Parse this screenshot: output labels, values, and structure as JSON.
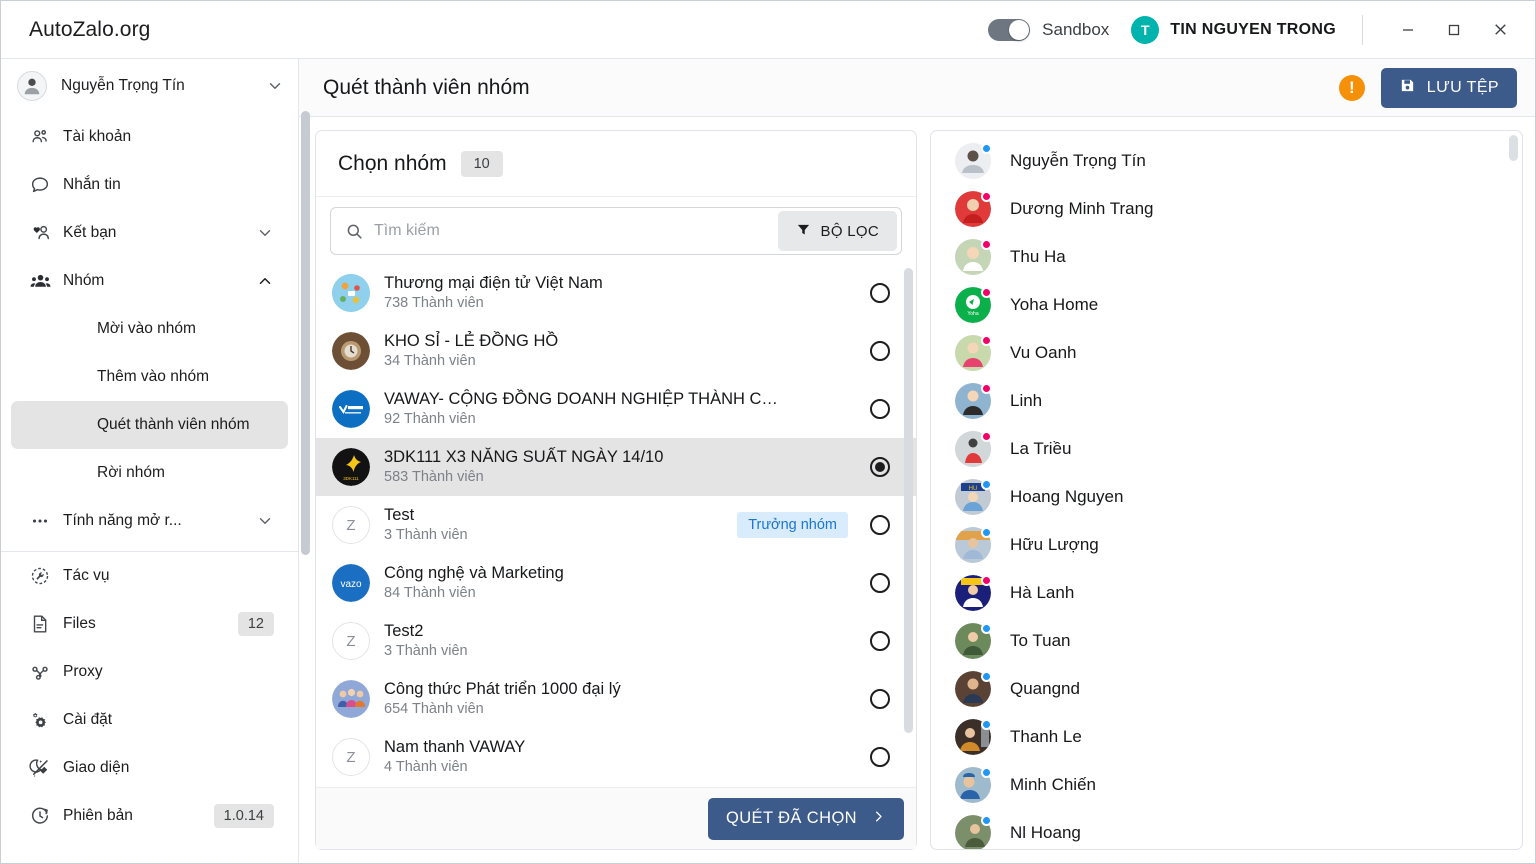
{
  "titlebar": {
    "app_title": "AutoZalo.org",
    "sandbox_label": "Sandbox",
    "sandbox_on": false,
    "user_initial": "T",
    "user_name": "TIN NGUYEN TRONG",
    "minimize": "–",
    "maximize": "□",
    "close": "×",
    "accent_avatar": "#00b3ad"
  },
  "sidebar": {
    "account_name": "Nguyễn Trọng Tín",
    "items": [
      {
        "label": "Tài khoản",
        "icon": "users-icon",
        "type": "item"
      },
      {
        "label": "Nhắn tin",
        "icon": "chat-icon",
        "type": "item"
      },
      {
        "label": "Kết bạn",
        "icon": "add-friend-icon",
        "type": "item",
        "chevron": "down"
      },
      {
        "label": "Nhóm",
        "icon": "group-icon",
        "type": "item",
        "chevron": "up"
      },
      {
        "label": "Mời vào nhóm",
        "type": "sub"
      },
      {
        "label": "Thêm vào nhóm",
        "type": "sub"
      },
      {
        "label": "Quét thành viên nhóm",
        "type": "sub",
        "active": true
      },
      {
        "label": "Rời nhóm",
        "type": "sub"
      },
      {
        "label": "Tính năng mở r...",
        "icon": "dots-icon",
        "type": "item",
        "chevron": "down"
      }
    ],
    "bottom_items": [
      {
        "label": "Tác vụ",
        "icon": "task-icon"
      },
      {
        "label": "Files",
        "icon": "file-icon",
        "badge": "12"
      },
      {
        "label": "Proxy",
        "icon": "proxy-icon"
      },
      {
        "label": "Cài đặt",
        "icon": "gear-icon"
      },
      {
        "label": "Giao diện",
        "icon": "theme-icon"
      },
      {
        "label": "Phiên bản",
        "icon": "version-icon",
        "badge": "1.0.14"
      }
    ]
  },
  "header": {
    "page_title": "Quét thành viên nhóm",
    "warning_symbol": "!",
    "save_label": "LƯU TỆP",
    "save_color": "#3c5b8b",
    "warning_color": "#f79009"
  },
  "group_panel": {
    "title": "Chọn nhóm",
    "count": "10",
    "search_placeholder": "Tìm kiếm",
    "search_value": "",
    "filter_label": "BỘ LỌC",
    "scan_label": "QUÉT ĐÃ CHỌN",
    "member_suffix": "Thành viên",
    "leader_tag": "Trưởng nhóm",
    "groups": [
      {
        "name": "Thương mại điện tử Việt Nam",
        "members": "738 Thành viên",
        "selected": false,
        "avatar_type": "image",
        "avatar_color": "#7fc7e8",
        "initial": ""
      },
      {
        "name": "KHO SỈ - LẺ ĐỒNG HỒ",
        "members": "34 Thành viên",
        "selected": false,
        "avatar_type": "image",
        "avatar_color": "#8a6a4a",
        "initial": ""
      },
      {
        "name": "VAWAY- CỘNG ĐỒNG DOANH NGHIỆP THÀNH C…",
        "members": "92 Thành viên",
        "selected": false,
        "avatar_type": "image",
        "avatar_color": "#0a69c0",
        "initial": ""
      },
      {
        "name": "3DK111 X3 NĂNG SUẤT NGÀY 14/10",
        "members": "583 Thành viên",
        "selected": true,
        "avatar_type": "image",
        "avatar_color": "#161616",
        "initial": ""
      },
      {
        "name": "Test",
        "members": "3 Thành viên",
        "selected": false,
        "avatar_type": "letter",
        "avatar_color": "#ffffff",
        "initial": "Z",
        "tag": "Trưởng nhóm"
      },
      {
        "name": "Công nghệ và Marketing",
        "members": "84 Thành viên",
        "selected": false,
        "avatar_type": "image",
        "avatar_color": "#1b6fc2",
        "initial": ""
      },
      {
        "name": "Test2",
        "members": "3 Thành viên",
        "selected": false,
        "avatar_type": "letter",
        "avatar_color": "#ffffff",
        "initial": "Z"
      },
      {
        "name": "Công thức Phát triển 1000 đại lý",
        "members": "654 Thành viên",
        "selected": false,
        "avatar_type": "image",
        "avatar_color": "#6d8ecf",
        "initial": ""
      },
      {
        "name": "Nam thanh VAWAY",
        "members": "4 Thành viên",
        "selected": false,
        "avatar_type": "letter",
        "avatar_color": "#ffffff",
        "initial": "Z"
      }
    ]
  },
  "member_panel": {
    "members": [
      {
        "name": "Nguyễn Trọng Tín",
        "status": "blue",
        "avatar_color": "#e6e8ec"
      },
      {
        "name": "Dương Minh Trang",
        "status": "pink",
        "avatar_color": "#e03a3a"
      },
      {
        "name": "Thu Ha",
        "status": "pink",
        "avatar_color": "#b7c9a8"
      },
      {
        "name": "Yoha Home",
        "status": "pink",
        "avatar_color": "#0bb04a"
      },
      {
        "name": "Vu Oanh",
        "status": "pink",
        "avatar_color": "#c3d3a6"
      },
      {
        "name": "Linh",
        "status": "pink",
        "avatar_color": "#7fa8c9"
      },
      {
        "name": "La Triều",
        "status": "pink",
        "avatar_color": "#cfd4d8"
      },
      {
        "name": "Hoang Nguyen",
        "status": "blue",
        "avatar_color": "#c2cbd3"
      },
      {
        "name": "Hữu Lượng",
        "status": "blue",
        "avatar_color": "#b0bfce"
      },
      {
        "name": "Hà Lanh",
        "status": "pink",
        "avatar_color": "#1a1f7a"
      },
      {
        "name": "To Tuan",
        "status": "blue",
        "avatar_color": "#6d8a5c"
      },
      {
        "name": "Quangnd",
        "status": "blue",
        "avatar_color": "#5a4335"
      },
      {
        "name": "Thanh Le",
        "status": "blue",
        "avatar_color": "#3b2f28"
      },
      {
        "name": "Minh Chiến",
        "status": "blue",
        "avatar_color": "#8ba7bd"
      },
      {
        "name": "Nl Hoang",
        "status": "blue",
        "avatar_color": "#7b8f6a"
      }
    ],
    "status_colors": {
      "blue": "#2196f3",
      "pink": "#f4006b"
    }
  }
}
